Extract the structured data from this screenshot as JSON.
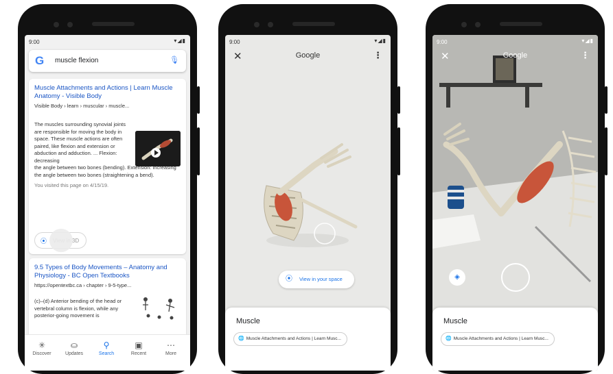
{
  "status": {
    "time": "9:00",
    "icons": "▾◢▮"
  },
  "phone1": {
    "search": {
      "logo": "G",
      "query": "muscle flexion",
      "mic": "🎙"
    },
    "result1": {
      "title": "Muscle Attachments and Actions | Learn Muscle Anatomy - Visible Body",
      "url": "Visible Body › learn › muscular › muscle...",
      "snippet_top": "The muscles surrounding synovial joints are responsible for moving the body in space. These muscle actions are often paired, like flexion and extension or abduction and adduction. ... Flexion: decreasing",
      "snippet_bottom": "the angle between two bones (bending). Extension: increasing the angle between two bones (straightening a bend).",
      "visited": "You visited this page on 4/15/19.",
      "view3d": "View in 3D"
    },
    "result2": {
      "title": "9.5 Types of Body Movements – Anatomy and Physiology - BC Open Textbooks",
      "url": "https://opentextbc.ca › chapter › 9-5-type...",
      "snippet": "(c)–(d) Anterior bending of the head or vertebral column is flexion, while any posterior-going movement is"
    },
    "nav": [
      {
        "icon": "✳",
        "label": "Discover"
      },
      {
        "icon": "⛀",
        "label": "Updates"
      },
      {
        "icon": "⚲",
        "label": "Search"
      },
      {
        "icon": "▣",
        "label": "Recent"
      },
      {
        "icon": "⋯",
        "label": "More"
      }
    ]
  },
  "phone2": {
    "close": "✕",
    "title": "Google",
    "menu": "⋮",
    "view_button": "View in your space",
    "sheet_title": "Muscle",
    "chip": "Muscle Attachments and Actions | Learn Musc..."
  },
  "phone3": {
    "close": "✕",
    "title": "Google",
    "menu": "⋮",
    "sheet_title": "Muscle",
    "chip": "Muscle Attachments and Actions | Learn Musc..."
  },
  "colors": {
    "link": "#1a55c4",
    "accent": "#1a73e8",
    "muscle": "#c8553a",
    "bone": "#ddd6c2"
  }
}
